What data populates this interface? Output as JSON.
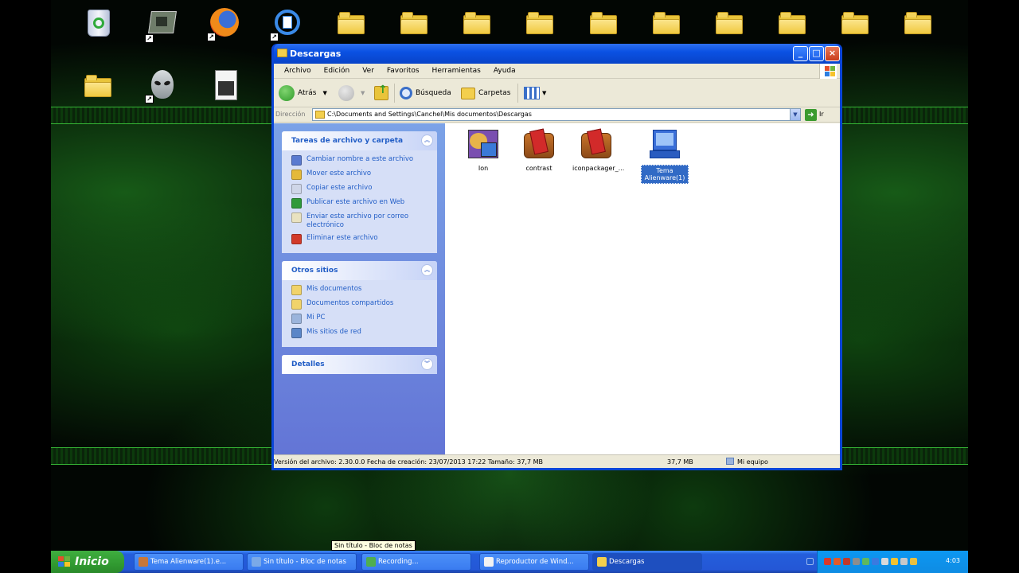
{
  "window": {
    "title": "Descargas",
    "menus": [
      "Archivo",
      "Edición",
      "Ver",
      "Favoritos",
      "Herramientas",
      "Ayuda"
    ],
    "toolbar": {
      "back_label": "Atrás",
      "search_label": "Búsqueda",
      "folders_label": "Carpetas"
    },
    "address": {
      "label": "Dirección",
      "path": "C:\\Documents and Settings\\Canchel\\Mis documentos\\Descargas",
      "go_label": "Ir"
    },
    "tasks_panel": {
      "title": "Tareas de archivo y carpeta",
      "items": [
        {
          "label": "Cambiar nombre a este archivo",
          "icon": "rename-icon",
          "color": "#5a7ad0"
        },
        {
          "label": "Mover este archivo",
          "icon": "move-icon",
          "color": "#e4b93a"
        },
        {
          "label": "Copiar este archivo",
          "icon": "copy-icon",
          "color": "#cfd6e8"
        },
        {
          "label": "Publicar este archivo en Web",
          "icon": "globe-icon",
          "color": "#2f9a3a"
        },
        {
          "label": "Enviar este archivo por correo electrónico",
          "icon": "email-icon",
          "color": "#e9e2c0"
        },
        {
          "label": "Eliminar este archivo",
          "icon": "delete-icon",
          "color": "#d23a2a"
        }
      ]
    },
    "places_panel": {
      "title": "Otros sitios",
      "items": [
        {
          "label": "Mis documentos",
          "icon": "my-documents-icon",
          "color": "#f1d36a"
        },
        {
          "label": "Documentos compartidos",
          "icon": "shared-documents-icon",
          "color": "#f1d36a"
        },
        {
          "label": "Mi PC",
          "icon": "my-computer-icon",
          "color": "#9bb4dc"
        },
        {
          "label": "Mis sitios de red",
          "icon": "network-places-icon",
          "color": "#5b86c8"
        }
      ]
    },
    "details_panel": {
      "title": "Detalles"
    },
    "files": [
      {
        "label": "Ion",
        "icon": "paint-palette-icon",
        "selected": false
      },
      {
        "label": "contrast",
        "icon": "installer-box-icon",
        "selected": false
      },
      {
        "label": "iconpackager_...",
        "icon": "installer-box-icon",
        "selected": false
      },
      {
        "label": "Tema Alienware(1)",
        "icon": "setup-computer-icon",
        "selected": true
      }
    ],
    "status": {
      "info": "Versión del archivo: 2.30.0.0 Fecha de creación: 23/07/2013 17:22 Tamaño: 37,7 MB",
      "size": "37,7 MB",
      "zone": "Mi equipo"
    }
  },
  "taskbar": {
    "start_label": "Inicio",
    "buttons": [
      {
        "label": "Tema Alienware(1).e...",
        "color": "#c9773a"
      },
      {
        "label": "Sin título - Bloc de notas",
        "color": "#7aa9e8"
      },
      {
        "label": "Recording...",
        "color": "#4fae4f"
      },
      {
        "label": "Reproductor de Wind...",
        "color": "#f2f2f2"
      },
      {
        "label": "Descargas",
        "color": "#f3cf4d"
      }
    ],
    "tooltip": "Sin título - Bloc de notas",
    "clock": "4:03"
  },
  "colors": {
    "accent_blue": "#0a46d8",
    "taskpane_link": "#215dc6",
    "selection": "#316ac5",
    "start_green": "#319a31"
  }
}
